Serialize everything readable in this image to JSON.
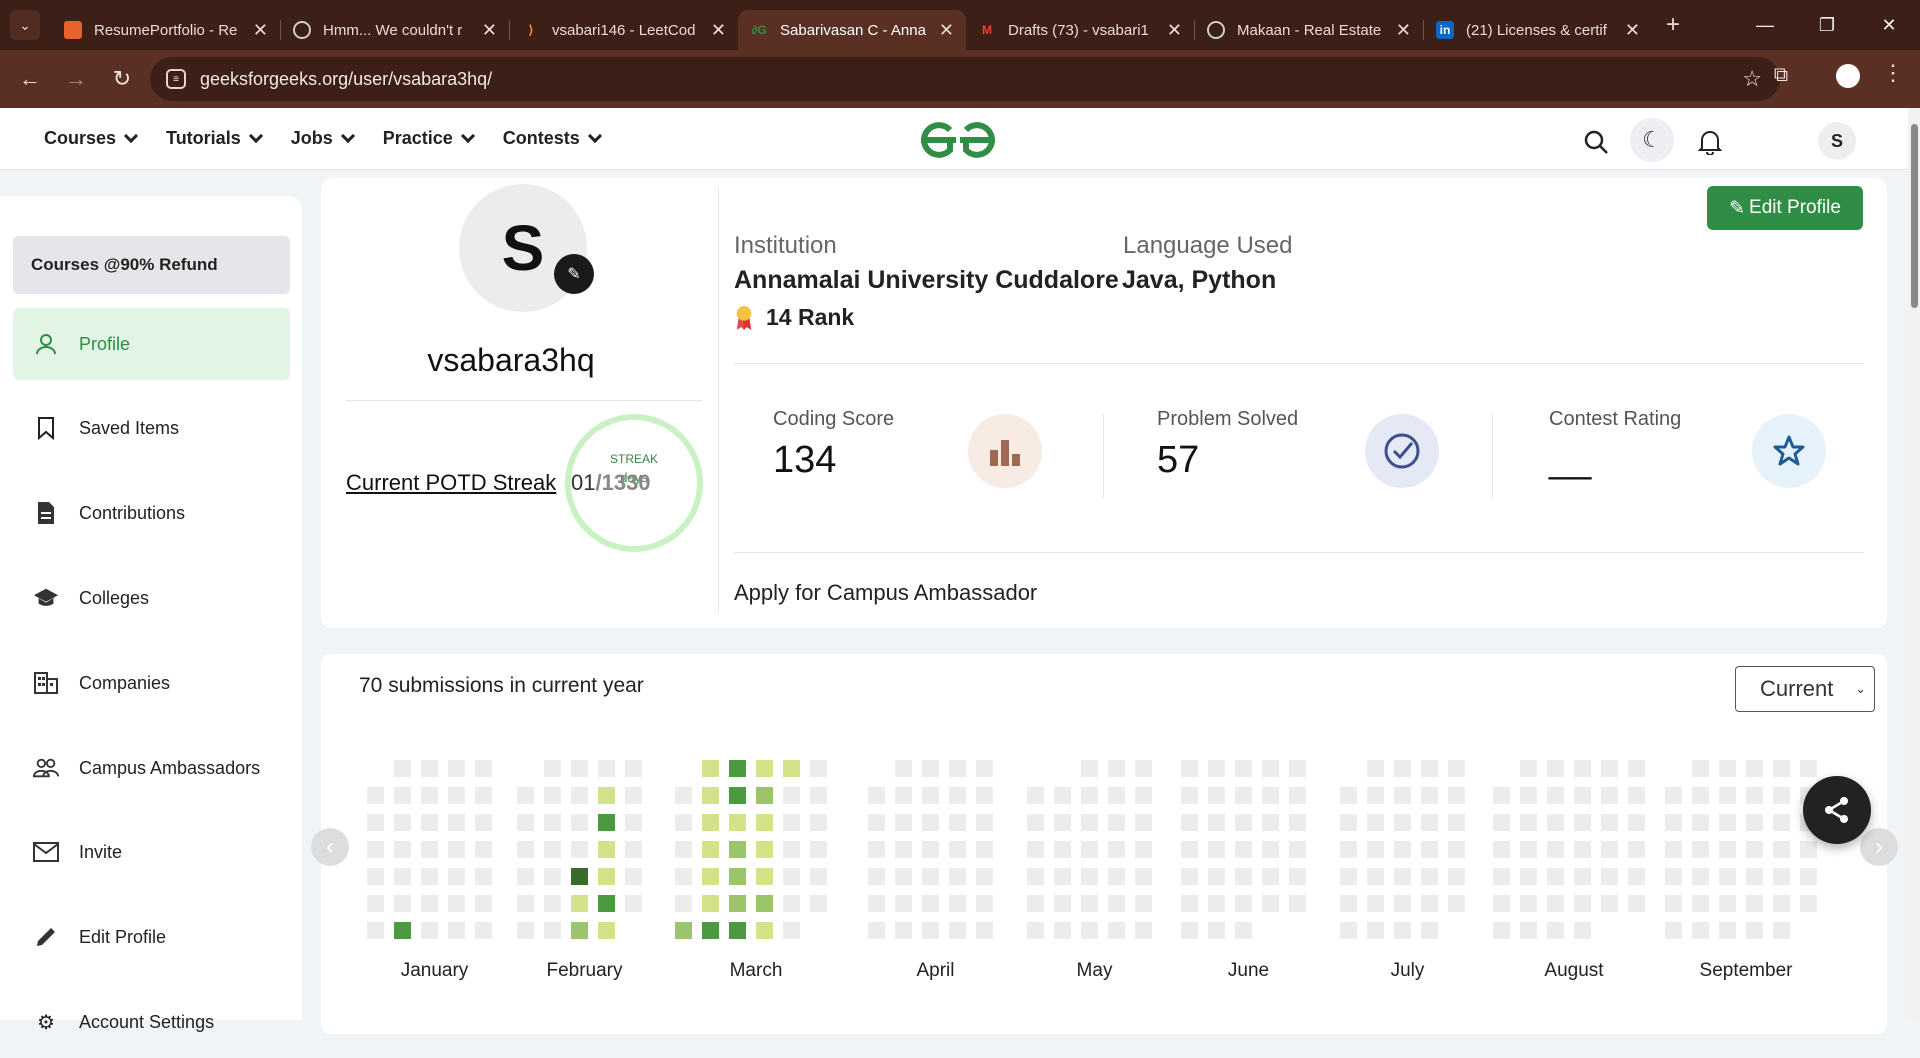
{
  "browser": {
    "tabs": [
      {
        "title": "ResumePortfolio - Re",
        "icon": "resume-favicon",
        "color": "#e8632b"
      },
      {
        "title": "Hmm... We couldn't r",
        "icon": "globe-icon",
        "color": "#cccccc"
      },
      {
        "title": "vsabari146 - LeetCod",
        "icon": "leetcode-icon",
        "color": "#f89f1b"
      },
      {
        "title": "Sabarivasan C - Anna",
        "icon": "gfg-icon",
        "color": "#2f8d46",
        "active": true
      },
      {
        "title": "Drafts (73) - vsabari1",
        "icon": "gmail-icon",
        "color": "#ea4335"
      },
      {
        "title": "Makaan - Real Estate",
        "icon": "globe-icon",
        "color": "#cccccc"
      },
      {
        "title": "(21) Licenses & certif",
        "icon": "linkedin-icon",
        "color": "#0a66c2"
      }
    ],
    "url": "geeksforgeeks.org/user/vsabara3hq/"
  },
  "nav": {
    "items": [
      "Courses",
      "Tutorials",
      "Jobs",
      "Practice",
      "Contests"
    ],
    "logo": "GfG",
    "avatar_letter": "S"
  },
  "sidebar": {
    "promo": "Courses @90% Refund",
    "items": [
      {
        "label": "Profile",
        "icon": "person-icon",
        "active": true
      },
      {
        "label": "Saved Items",
        "icon": "bookmark-icon"
      },
      {
        "label": "Contributions",
        "icon": "document-icon"
      },
      {
        "label": "Colleges",
        "icon": "graduation-cap-icon"
      },
      {
        "label": "Companies",
        "icon": "building-icon"
      },
      {
        "label": "Campus Ambassadors",
        "icon": "people-icon"
      },
      {
        "label": "Invite",
        "icon": "mail-icon"
      },
      {
        "label": "Edit Profile",
        "icon": "pencil-icon"
      },
      {
        "label": "Account Settings",
        "icon": "gear-icon"
      }
    ]
  },
  "profile": {
    "avatar_letter": "S",
    "username": "vsabara3hq",
    "potd_label": "Current POTD Streak",
    "streak": {
      "caption": "STREAK",
      "current": "01",
      "total": "/1330",
      "unit": "days"
    },
    "edit_label": "Edit Profile",
    "institution_label": "Institution",
    "institution": "Annamalai University Cuddalore",
    "language_label": "Language Used",
    "language": "Java, Python",
    "rank": "14 Rank",
    "stats": [
      {
        "label": "Coding Score",
        "value": "134",
        "icon": "bar-chart-icon"
      },
      {
        "label": "Problem Solved",
        "value": "57",
        "icon": "check-circle-icon"
      },
      {
        "label": "Contest Rating",
        "value": "__",
        "icon": "star-icon"
      }
    ],
    "campus": "Apply for Campus Ambassador"
  },
  "submissions": {
    "title": "70 submissions in current year",
    "select": "Current",
    "months": [
      "January",
      "February",
      "March",
      "April",
      "May",
      "June",
      "July",
      "August",
      "September"
    ],
    "colors": {
      "empty": "#ececec",
      "l1": "#d3e38a",
      "l2": "#9bc46b",
      "l3": "#4b9a3f",
      "l4": "#386a2a"
    }
  }
}
